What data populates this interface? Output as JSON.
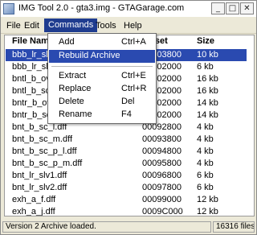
{
  "window": {
    "title": "IMG Tool 2.0 - gta3.img - GTAGarage.com",
    "minimize": "_",
    "maximize": "□",
    "close": "✕"
  },
  "menubar": [
    "File",
    "Edit",
    "Commands",
    "Tools",
    "Help"
  ],
  "active_menu": "Commands",
  "list": {
    "headers": {
      "name": "File Name",
      "offset": "Offset",
      "size": "Size"
    },
    "rows": [
      {
        "name": "bbb_lr_sl...",
        "offset": "00003800",
        "size": "10 kb",
        "selected": true
      },
      {
        "name": "bbb_lr_sl...",
        "offset": "00002000",
        "size": "6 kb"
      },
      {
        "name": "bntl_b_ov...",
        "offset": "00002000",
        "size": "16 kb"
      },
      {
        "name": "bntl_b_sq...",
        "offset": "00002000",
        "size": "16 kb"
      },
      {
        "name": "bntr_b_ov...",
        "offset": "00002000",
        "size": "14 kb"
      },
      {
        "name": "bntr_b_sq...",
        "offset": "00002000",
        "size": "14 kb"
      },
      {
        "name": "bnt_b_sc_l.dff",
        "offset": "00092800",
        "size": "4 kb"
      },
      {
        "name": "bnt_b_sc_m.dff",
        "offset": "00093800",
        "size": "4 kb"
      },
      {
        "name": "bnt_b_sc_p_l.dff",
        "offset": "00094800",
        "size": "4 kb"
      },
      {
        "name": "bnt_b_sc_p_m.dff",
        "offset": "00095800",
        "size": "4 kb"
      },
      {
        "name": "bnt_lr_slv1.dff",
        "offset": "00096800",
        "size": "6 kb"
      },
      {
        "name": "bnt_lr_slv2.dff",
        "offset": "00097800",
        "size": "6 kb"
      },
      {
        "name": "exh_a_f.dff",
        "offset": "00099000",
        "size": "12 kb"
      },
      {
        "name": "exh_a_j.dff",
        "offset": "0009C000",
        "size": "12 kb"
      }
    ]
  },
  "commands_menu": {
    "items": [
      {
        "label": "Add",
        "shortcut": "Ctrl+A"
      },
      {
        "label": "Rebuild Archive",
        "shortcut": "",
        "highlighted": true
      },
      {
        "separator": true
      },
      {
        "label": "Extract",
        "shortcut": "Ctrl+E"
      },
      {
        "label": "Replace",
        "shortcut": "Ctrl+R"
      },
      {
        "label": "Delete",
        "shortcut": "Del"
      },
      {
        "label": "Rename",
        "shortcut": "F4"
      }
    ]
  },
  "status": {
    "message": "Version 2 Archive loaded.",
    "count": "16316 files"
  },
  "colors": {
    "selection": "#2a4ab0",
    "menu_active": "#1f3c8f",
    "chrome": "#ece9d8"
  }
}
